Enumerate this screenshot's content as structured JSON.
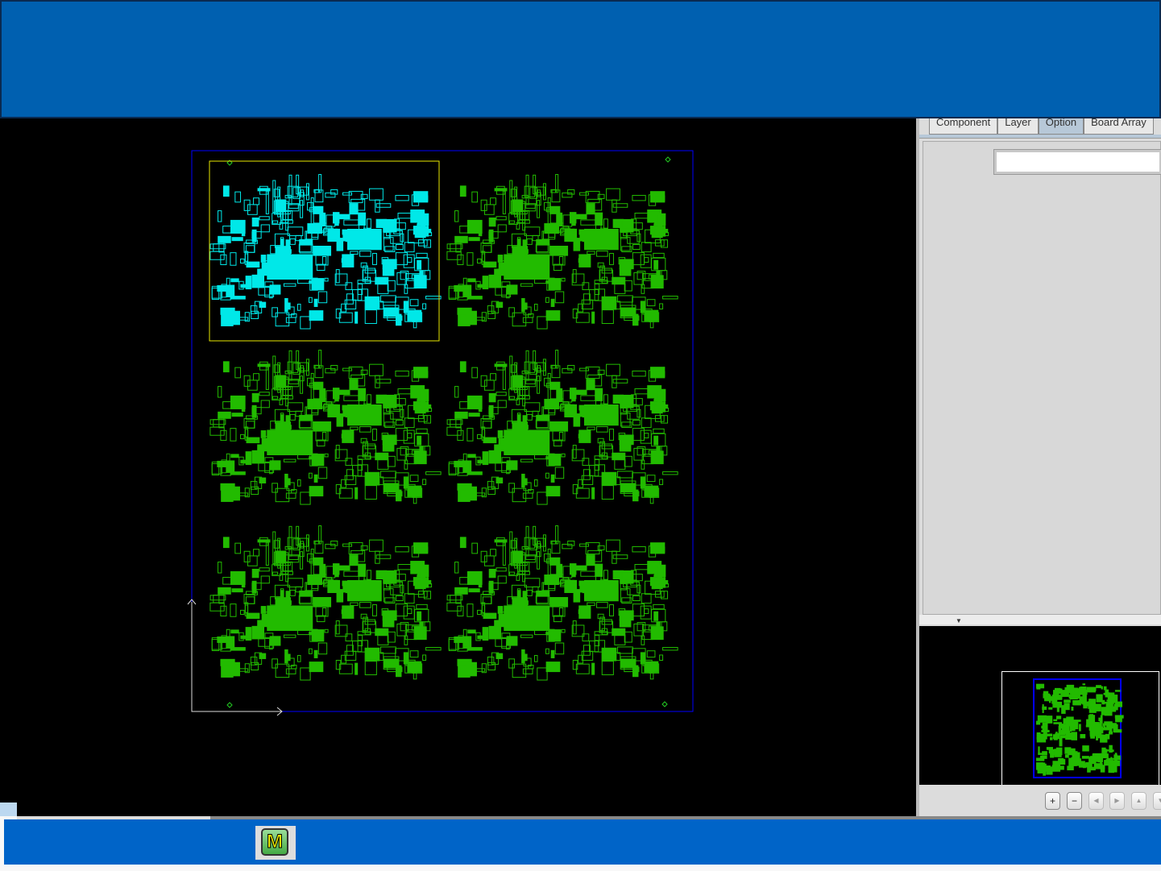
{
  "panel": {
    "tabs": [
      {
        "label": "Component",
        "active": false
      },
      {
        "label": "Layer",
        "active": false
      },
      {
        "label": "Option",
        "active": true
      },
      {
        "label": "Board Array",
        "active": false
      }
    ],
    "field_value": ""
  },
  "overview_buttons": [
    {
      "icon": "zoom-in-icon",
      "glyph": "+"
    },
    {
      "icon": "zoom-out-icon",
      "glyph": "−"
    },
    {
      "icon": "pan-left-icon",
      "glyph": "◀"
    },
    {
      "icon": "pan-right-icon",
      "glyph": "▶"
    },
    {
      "icon": "pan-up-icon",
      "glyph": "▲"
    },
    {
      "icon": "pan-down-icon",
      "glyph": "▼"
    }
  ],
  "taskbar": {
    "app_icon_letter": "M"
  },
  "colors": {
    "board_normal": "#22bb00",
    "board_selected": "#00e8e8",
    "selection_frame": "#e8e800",
    "panel_outline": "#0000ff",
    "titlebar": "#0060b0"
  },
  "board_array": {
    "rows": 3,
    "cols": 2,
    "selected_index": 0
  }
}
